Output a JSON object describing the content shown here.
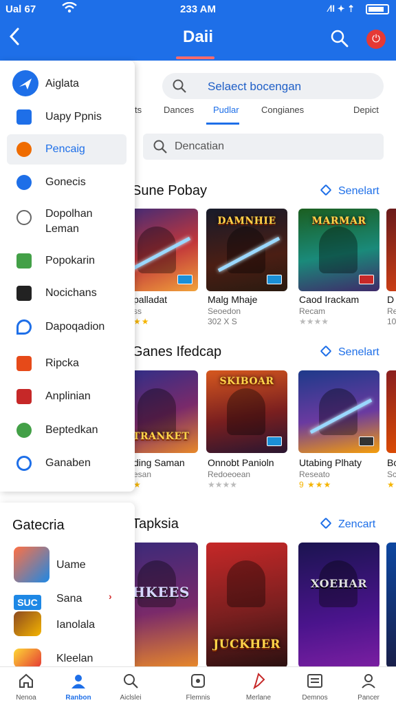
{
  "status_bar": {
    "signal": "Ual 67",
    "time": "233 AM",
    "right_icons": "⁄ll ✦ ⇡"
  },
  "header": {
    "title": "Daii"
  },
  "main": {
    "search_placeholder": "Selaect bocengan",
    "tabs": [
      {
        "label": "ts"
      },
      {
        "label": "Dances"
      },
      {
        "label": "Pudlar"
      },
      {
        "label": "Congianes"
      },
      {
        "label": "Depict"
      }
    ],
    "search2_placeholder": "Dencatian",
    "sections": [
      {
        "title": "Sune Pobay",
        "see_label": "Senelart",
        "cards": [
          {
            "title": "palladat",
            "sub": "ss",
            "meta": "★★"
          },
          {
            "title": "Malg Mhaje",
            "sub": "Seoedon",
            "meta": "302 X S",
            "logo": "DAMNHIE"
          },
          {
            "title": "Caod Irackam",
            "sub": "Recam",
            "meta": "★★★★",
            "logo": "MARMAR"
          },
          {
            "title": "D",
            "sub": "Re",
            "meta": "10"
          }
        ]
      },
      {
        "title": "Ganes Ifedcap",
        "see_label": "Senelart",
        "cards": [
          {
            "title": "ding Saman",
            "sub": "esan",
            "meta": "★",
            "logo": "STRANKET"
          },
          {
            "title": "Onnobt Panioln",
            "sub": "Redoeoean",
            "meta": "★★★★",
            "logo": "SKIBOAR"
          },
          {
            "title": "Utabing Plhaty",
            "sub": "Reseato",
            "meta": "9 ★★★",
            "logo": ""
          },
          {
            "title": "Bo",
            "sub": "Sc",
            "meta": "★"
          }
        ]
      },
      {
        "title": "Tapksia",
        "see_label": "Zencart",
        "cards": [
          {
            "logo": "JHKEES"
          },
          {
            "logo": "JUCKHER"
          },
          {
            "logo": "XOEHAR"
          },
          {
            "logo": ""
          }
        ]
      }
    ]
  },
  "drawer": {
    "items": [
      {
        "label": "Aiglata"
      },
      {
        "label": "Uapy Ppnis"
      },
      {
        "label": "Pencaig"
      },
      {
        "label": "Gonecis"
      },
      {
        "label": "Dopolhan\nLeman"
      },
      {
        "label": "Popokarin"
      },
      {
        "label": "Nocichans"
      },
      {
        "label": "Dapoqadion"
      },
      {
        "label": "Ripcka"
      },
      {
        "label": "Anplinian"
      },
      {
        "label": "Beptedkan"
      },
      {
        "label": "Ganaben"
      }
    ]
  },
  "categories": {
    "title": "Gatecria",
    "items": [
      {
        "label": "Uame"
      },
      {
        "label": "Sana",
        "icon_text": "SUC"
      },
      {
        "label": "Ianolala"
      },
      {
        "label": "Kleelan"
      }
    ]
  },
  "bottom_nav": [
    {
      "label": "Nenoa"
    },
    {
      "label": "Ranbon"
    },
    {
      "label": "Aiclslei"
    },
    {
      "label": "Flemnis"
    },
    {
      "label": "Merlane"
    },
    {
      "label": "Demnos"
    },
    {
      "label": "Pancer"
    }
  ],
  "colors": {
    "accent": "#1e6fe8",
    "header": "#1e6fe8",
    "power": "#e53935",
    "star": "#f5b400"
  }
}
